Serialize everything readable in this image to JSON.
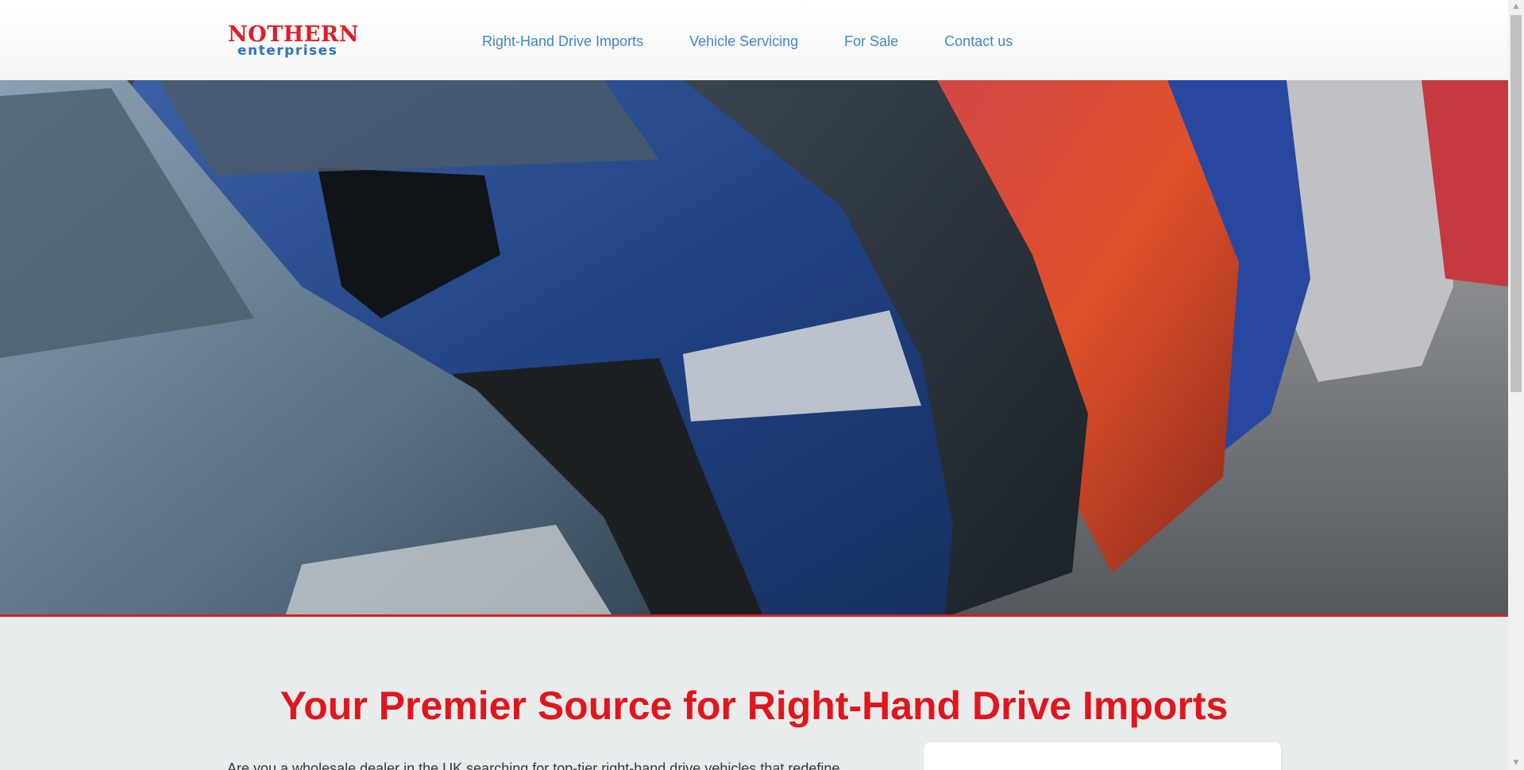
{
  "logo": {
    "line1": "NOTHERN",
    "line2": "enterprises"
  },
  "nav": {
    "items": [
      {
        "label": "Right-Hand Drive Imports"
      },
      {
        "label": "Vehicle Servicing"
      },
      {
        "label": "For Sale"
      },
      {
        "label": "Contact us"
      }
    ]
  },
  "hero": {
    "image": "row-of-parked-cars-photo"
  },
  "main": {
    "headline": "Your Premier Source for Right-Hand Drive Imports",
    "intro": "Are you a wholesale dealer in the UK searching for top-tier right-hand drive vehicles that redefine"
  },
  "scrollbar": {
    "up_icon": "▲",
    "down_icon": "▼"
  },
  "colors": {
    "brand_red": "#dc1f26",
    "brand_blue": "#2f72b8",
    "nav_link": "#3f86c7",
    "headline": "#e1161d",
    "page_background": "#e9ecec"
  }
}
